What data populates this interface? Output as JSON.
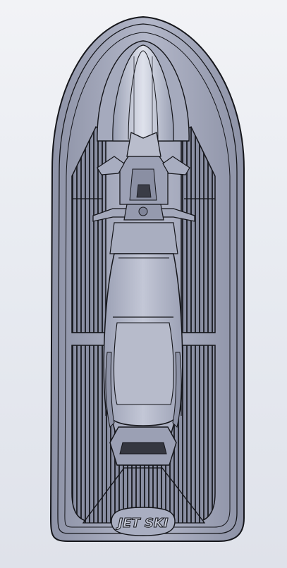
{
  "viewport": {
    "background_top": "#f2f3f6",
    "background_bottom": "#dfe2ea"
  },
  "model": {
    "colors": {
      "hull_fill": "#9ea3b7",
      "hull_light": "#b8bccd",
      "hull_highlight": "#d6d9e4",
      "edge": "#15161b",
      "mat_stripe": "#2a2c34",
      "mat_fill": "#7f8498"
    },
    "parts": [
      "hull",
      "gunwale",
      "deck",
      "left-foot-mat",
      "right-foot-mat",
      "rear-deck-mat",
      "hood",
      "handlebar",
      "mirror-left",
      "mirror-right",
      "seat",
      "rear-step",
      "logo-plate"
    ],
    "logo_text": "JET SKI"
  }
}
